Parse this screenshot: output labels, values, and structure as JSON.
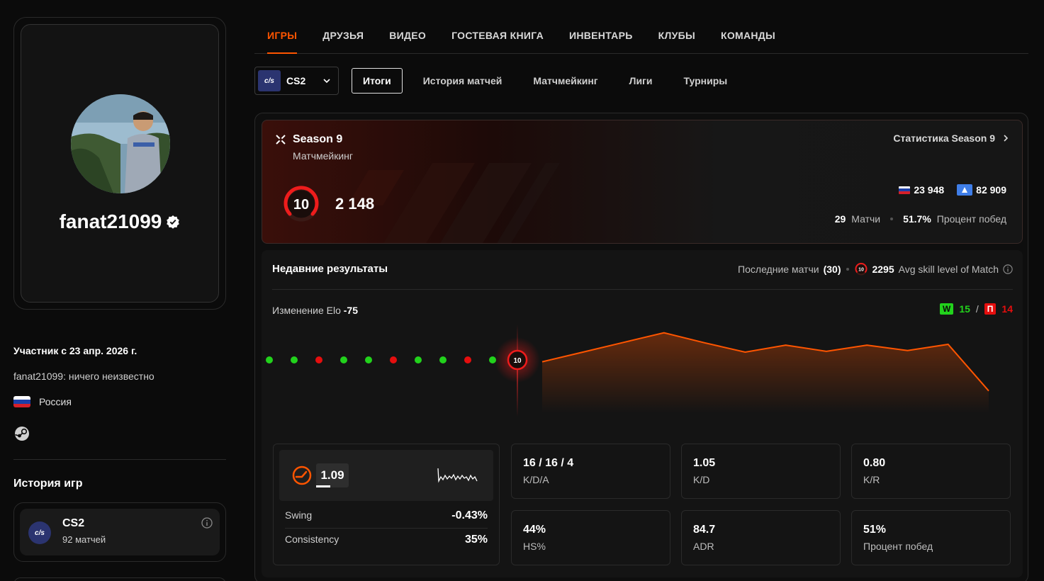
{
  "profile": {
    "nickname": "fanat21099",
    "member_since": "Участник с 23 апр. 2026 г.",
    "bio": "fanat21099: ничего неизвестно",
    "country": "Россия"
  },
  "game_history": {
    "title": "История игр",
    "game": "CS2",
    "matches": "92 матчей",
    "logo": "c/s"
  },
  "topnav": {
    "tabs": [
      "ИГРЫ",
      "ДРУЗЬЯ",
      "ВИДЕО",
      "ГОСТЕВАЯ КНИГА",
      "ИНВЕНТАРЬ",
      "КЛУБЫ",
      "КОМАНДЫ"
    ],
    "active_index": 0
  },
  "game_select": {
    "logo": "c/s",
    "name": "CS2"
  },
  "subtabs": {
    "items": [
      "Итоги",
      "История матчей",
      "Матчмейкинг",
      "Лиги",
      "Турниры"
    ],
    "active_index": 0
  },
  "season": {
    "title": "Season 9",
    "subtitle": "Матчмейкинг",
    "link": "Статистика Season 9",
    "level": "10",
    "elo": "2 148",
    "rank_country": "23 948",
    "rank_region": "82 909",
    "matches_value": "29",
    "matches_label": "Матчи",
    "winrate_value": "51.7%",
    "winrate_label": "Процент побед"
  },
  "recent": {
    "title": "Недавние результаты",
    "last_matches_label": "Последние матчи",
    "last_matches_count": "(30)",
    "avg_level": "10",
    "avg_value": "2295",
    "avg_label": "Avg skill level of Match",
    "elo_change_label": "Изменение Elo",
    "elo_change_value": "-75",
    "wins_badge": "W",
    "wins": "15",
    "losses_badge": "П",
    "losses": "14",
    "results": [
      "W",
      "W",
      "L",
      "W",
      "W",
      "L",
      "W",
      "W",
      "L",
      "W"
    ],
    "current_level": "10",
    "elo_trend": [
      2223,
      2248,
      2273,
      2298,
      2272,
      2248,
      2266,
      2250,
      2266,
      2252,
      2268,
      2148
    ]
  },
  "rating": {
    "value": "1.09",
    "swing_label": "Swing",
    "swing_value": "-0.43%",
    "consistency_label": "Consistency",
    "consistency_value": "35%"
  },
  "stats": [
    {
      "value": "16 / 16 / 4",
      "label": "K/D/A"
    },
    {
      "value": "1.05",
      "label": "K/D"
    },
    {
      "value": "0.80",
      "label": "K/R"
    },
    {
      "value": "44%",
      "label": "HS%"
    },
    {
      "value": "84.7",
      "label": "ADR"
    },
    {
      "value": "51%",
      "label": "Процент побед"
    }
  ],
  "colors": {
    "accent": "#ff5500",
    "win": "#22d21c",
    "loss": "#e50e0e"
  }
}
